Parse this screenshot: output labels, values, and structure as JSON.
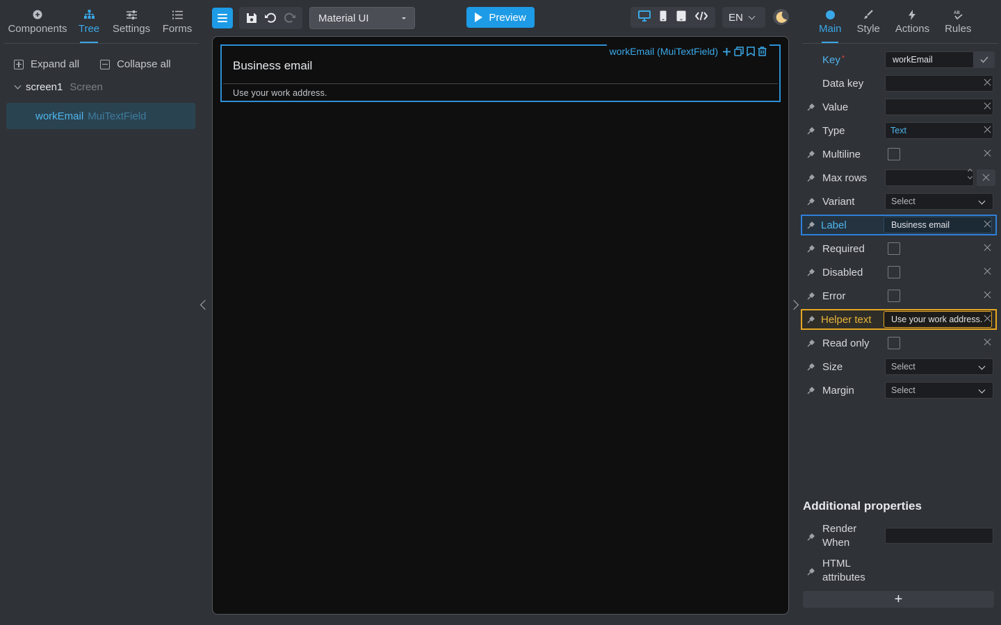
{
  "left_tabs": [
    {
      "label": "Components",
      "icon": "plus-circle-icon"
    },
    {
      "label": "Tree",
      "icon": "tree-icon",
      "active": true
    },
    {
      "label": "Settings",
      "icon": "sliders-icon"
    },
    {
      "label": "Forms",
      "icon": "list-icon"
    }
  ],
  "tree": {
    "expand_all": "Expand all",
    "collapse_all": "Collapse all",
    "root_name": "screen1",
    "root_type": "Screen",
    "node_name": "workEmail",
    "node_type": "MuiTextField"
  },
  "toolbar": {
    "theme": "Material UI",
    "preview": "Preview",
    "language": "EN"
  },
  "canvas": {
    "selection_label": "workEmail (MuiTextField)",
    "field_label": "Business email",
    "helper_text": "Use your work address."
  },
  "right_tabs": [
    {
      "label": "Main",
      "icon": "dot-icon",
      "active": true
    },
    {
      "label": "Style",
      "icon": "brush-icon"
    },
    {
      "label": "Actions",
      "icon": "bolt-icon"
    },
    {
      "label": "Rules",
      "icon": "rules-icon"
    }
  ],
  "props": {
    "key_label": "Key",
    "key_value": "workEmail",
    "data_key": "Data key",
    "value": "Value",
    "type": "Type",
    "type_value": "Text",
    "multiline": "Multiline",
    "max_rows": "Max rows",
    "variant": "Variant",
    "select_placeholder": "Select",
    "label": "Label",
    "label_value": "Business email",
    "required": "Required",
    "disabled": "Disabled",
    "error": "Error",
    "helper_text": "Helper text",
    "helper_text_value": "Use your work address.",
    "read_only": "Read only",
    "size": "Size",
    "margin": "Margin"
  },
  "additional": {
    "title": "Additional properties",
    "render_when": "Render When",
    "html_attributes": "HTML attributes",
    "add": "+"
  },
  "colors": {
    "accent": "#1e9be6",
    "label_highlight": "#2f80d9",
    "helper_highlight": "#e7a722",
    "background": "#2f3237",
    "canvas": "#0f0f0f"
  }
}
